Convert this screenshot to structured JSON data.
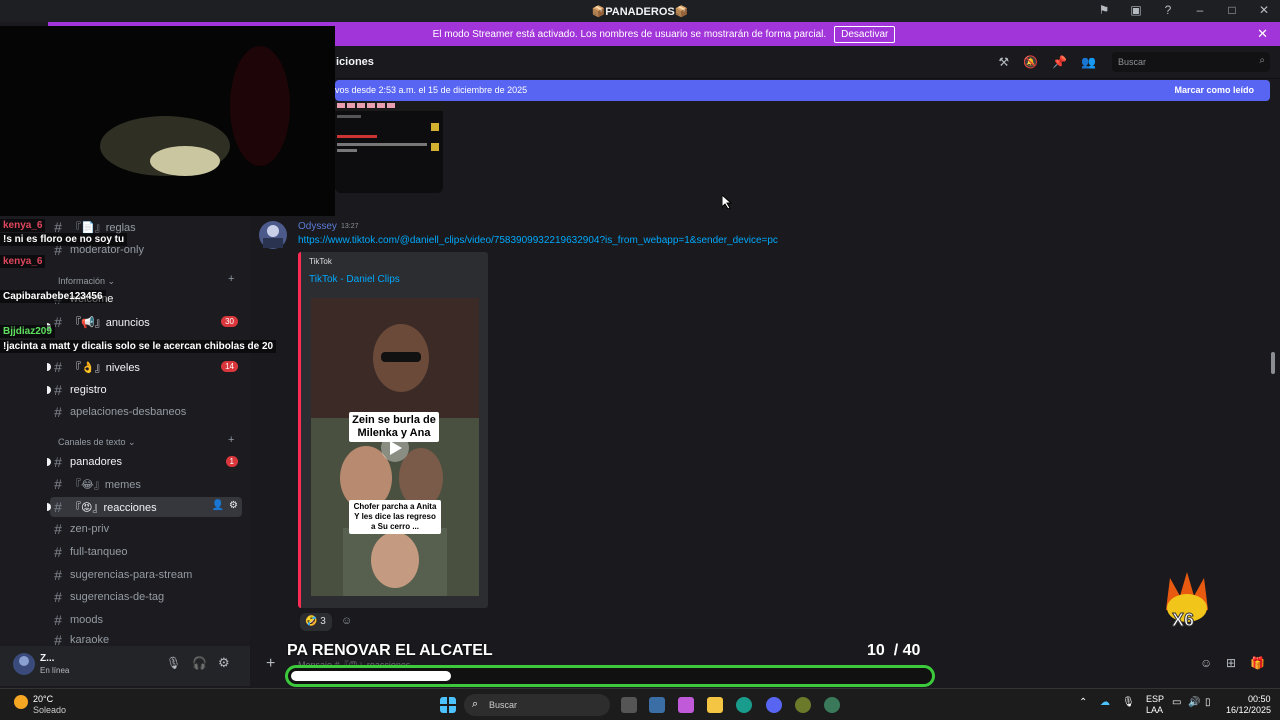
{
  "window": {
    "title": "📦PANADEROS📦"
  },
  "streamer_bar": {
    "text": "El modo Streamer está activado. Los nombres de usuario se mostrarán de forma parcial.",
    "button": "Desactivar"
  },
  "channel_header": {
    "name": "iciones",
    "search_placeholder": "Buscar"
  },
  "new_messages": {
    "text": "vos desde 2:53 a.m. el 15 de diciembre de 2025",
    "mark_read": "Marcar como leído"
  },
  "overlay_chat": [
    {
      "user": "kenya_6",
      "text": "!s ni es floro oe no soy tu",
      "color": "#e0465d"
    },
    {
      "user": "kenya_6",
      "text": "",
      "color": "#e0465d"
    },
    {
      "user": "Capibarabebe123456",
      "text": "",
      "color": "#ffffff"
    },
    {
      "user": "Bjjdiaz209",
      "text": "!jacinta a matt y dicalis solo se le acercan chibolas de 20",
      "color": "#5ee05e"
    }
  ],
  "sidebar": {
    "categories": [
      {
        "label": "Información ⌄"
      },
      {
        "label": "Canales de texto ⌄"
      }
    ],
    "channels": [
      {
        "label": "『📄』reglas",
        "unread": false,
        "badge": ""
      },
      {
        "label": "moderator-only",
        "unread": false,
        "badge": ""
      },
      {
        "label": "welcome",
        "unread": true,
        "badge": ""
      },
      {
        "label": "『📢』anuncios",
        "unread": true,
        "badge": "30"
      },
      {
        "label": "『👌』niveles",
        "unread": true,
        "badge": "14"
      },
      {
        "label": "registro",
        "unread": true,
        "badge": ""
      },
      {
        "label": "apelaciones-desbaneos",
        "unread": false,
        "badge": ""
      },
      {
        "label": "panadores",
        "unread": true,
        "badge": "1"
      },
      {
        "label": "『😂』memes",
        "unread": false,
        "badge": ""
      },
      {
        "label": "『😡』reacciones",
        "unread": true,
        "badge": ""
      },
      {
        "label": "zen-priv",
        "unread": false,
        "badge": ""
      },
      {
        "label": "full-tanqueo",
        "unread": false,
        "badge": ""
      },
      {
        "label": "sugerencias-para-stream",
        "unread": false,
        "badge": ""
      },
      {
        "label": "sugerencias-de-tag",
        "unread": false,
        "badge": ""
      },
      {
        "label": "moods",
        "unread": false,
        "badge": ""
      },
      {
        "label": "karaoke",
        "unread": false,
        "badge": ""
      }
    ]
  },
  "message": {
    "author": "Odyssey",
    "time": "13:27",
    "link": "https://www.tiktok.com/@daniell_clips/video/7583909932219632904?is_from_webapp=1&sender_device=pc",
    "embed_provider": "TikTok",
    "embed_title": "TikTok - Daniel Clips",
    "caption1": "Zein se burla de Milenka y Ana",
    "caption2": "Chofer parcha a Anita Y les dice las regreso a Su cerro ...",
    "reaction_count": "3"
  },
  "user_panel": {
    "name": "Z...",
    "status": "En línea"
  },
  "composer": {
    "placeholder": "Mensaje #『😡』reacciones"
  },
  "goal": {
    "label": "PA RENOVAR EL ALCATEL",
    "current": "10",
    "total": "/ 40",
    "progress": 0.25,
    "multiplier": "X6"
  },
  "taskbar": {
    "weather_temp": "20°C",
    "weather_desc": "Soleado",
    "search": "Buscar",
    "lang1": "ESP",
    "lang2": "LAA",
    "time": "00:50",
    "date": "16/12/2025"
  },
  "colors": {
    "streamer": "#a235d9",
    "new_bar": "#5865f2",
    "goal_border": "#3cc93c",
    "tiktok": "#fe2c55"
  }
}
